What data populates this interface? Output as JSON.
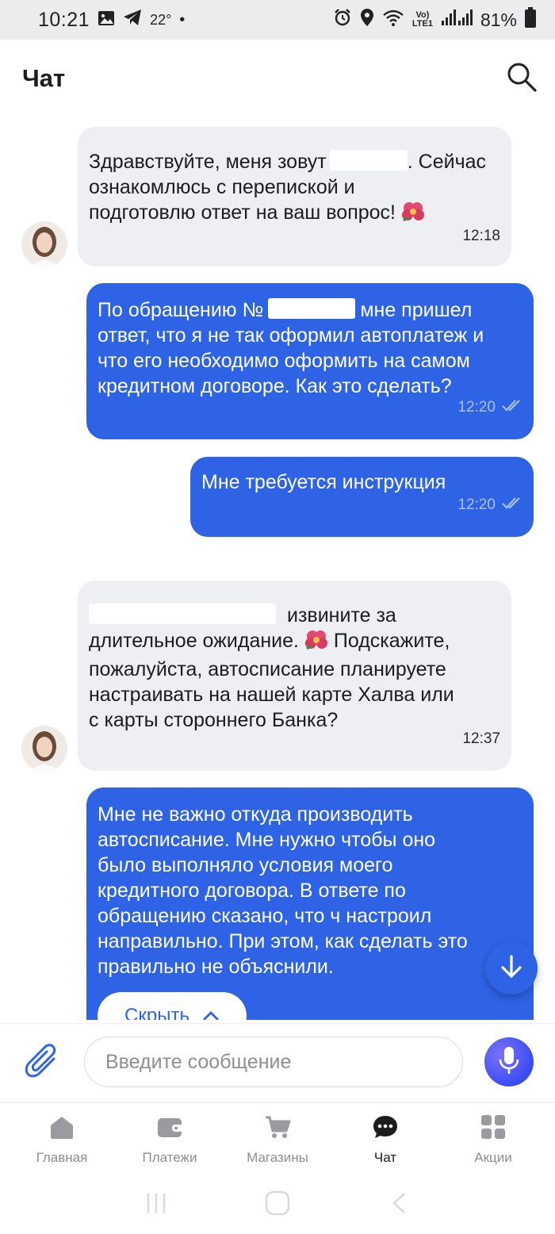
{
  "status_bar": {
    "time": "10:21",
    "temperature": "22°",
    "dot": "•",
    "lte_top": "Vo)",
    "lte_bottom": "LTE1",
    "battery_percent": "81%",
    "icons": [
      "gallery-icon",
      "telegram-icon",
      "alarm-icon",
      "location-icon",
      "wifi-icon",
      "signal-icon",
      "battery-icon"
    ]
  },
  "header": {
    "title": "Чат",
    "search_icon": "search-icon"
  },
  "messages": [
    {
      "direction": "in",
      "text_before": "Здравствуйте, меня зовут",
      "text_after": ". Сейчас\nознакомлюсь с перепиской и\nподготовлю ответ на ваш вопрос! ",
      "emoji": "hibiscus",
      "time": "12:18"
    },
    {
      "direction": "out",
      "text_before": "По обращению №",
      "text_after": "мне пришел\nответ, что я не так оформил автоплатеж и\nчто его необходимо оформить на самом\nкредитном договоре. Как это сделать?",
      "time": "12:20",
      "status": "read"
    },
    {
      "direction": "out",
      "text": "Мне требуется инструкция",
      "time": "12:20",
      "status": "read"
    },
    {
      "direction": "in",
      "text_line1": "извините за",
      "text_line2": "длительное ожидание. ",
      "text_line3": " Подскажите,\nпожалуйста, автосписание планируете\nнастраивать на нашей карте Халва или\nс карты стороннего Банка?",
      "emoji": "hibiscus",
      "time": "12:37"
    },
    {
      "direction": "out",
      "text": "Мне не важно откуда производить\nавтосписание. Мне нужно чтобы оно\nбыло выполняло условия моего\nкредитного договора. В ответе по\nобращению сказано, что ч настроил\nнаправильно. При этом, как сделать это\nправильно не объяснили.",
      "hide_label": "Скрыть",
      "status": "read"
    }
  ],
  "composer": {
    "placeholder": "Введите сообщение",
    "attach_icon": "paperclip-icon",
    "mic_icon": "microphone-icon"
  },
  "bottom_nav": [
    {
      "label": "Главная",
      "icon": "home-icon",
      "active": false
    },
    {
      "label": "Платежи",
      "icon": "wallet-icon",
      "active": false
    },
    {
      "label": "Магазины",
      "icon": "cart-icon",
      "active": false
    },
    {
      "label": "Чат",
      "icon": "chat-icon",
      "active": true
    },
    {
      "label": "Акции",
      "icon": "grid-icon",
      "active": false
    }
  ],
  "colors": {
    "accent": "#2e63e6",
    "incoming_bubble": "#eeeff3",
    "inactive_nav": "#8e8e93"
  }
}
